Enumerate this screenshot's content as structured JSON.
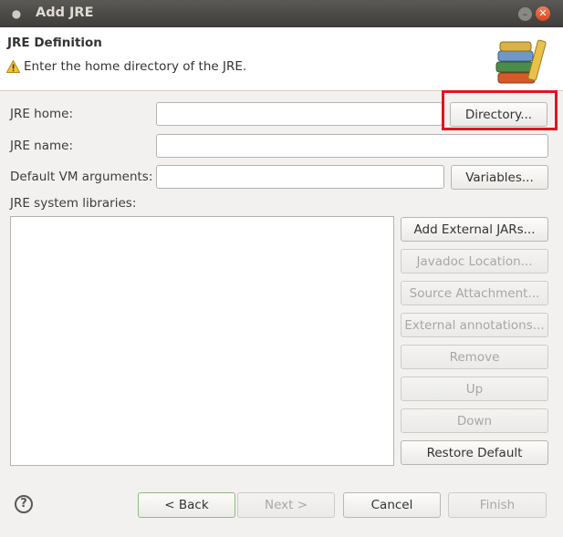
{
  "window": {
    "title": "Add JRE"
  },
  "header": {
    "title": "JRE Definition",
    "message": "Enter the home directory of the JRE."
  },
  "form": {
    "jre_home_label": "JRE home:",
    "jre_home_value": "",
    "jre_name_label": "JRE name:",
    "jre_name_value": "",
    "vm_args_label": "Default VM arguments:",
    "vm_args_value": "",
    "libraries_label": "JRE system libraries:"
  },
  "buttons": {
    "directory": "Directory...",
    "variables": "Variables...",
    "add_external_jars": "Add External JARs...",
    "javadoc_location": "Javadoc Location...",
    "source_attachment": "Source Attachment...",
    "external_annotations": "External annotations...",
    "remove": "Remove",
    "up": "Up",
    "down": "Down",
    "restore_default": "Restore Default"
  },
  "footer": {
    "back": "< Back",
    "next": "Next >",
    "cancel": "Cancel",
    "finish": "Finish"
  },
  "colors": {
    "highlight": "#e2141e",
    "titlebar": "#3e3d39",
    "close_button": "#e05a32"
  }
}
